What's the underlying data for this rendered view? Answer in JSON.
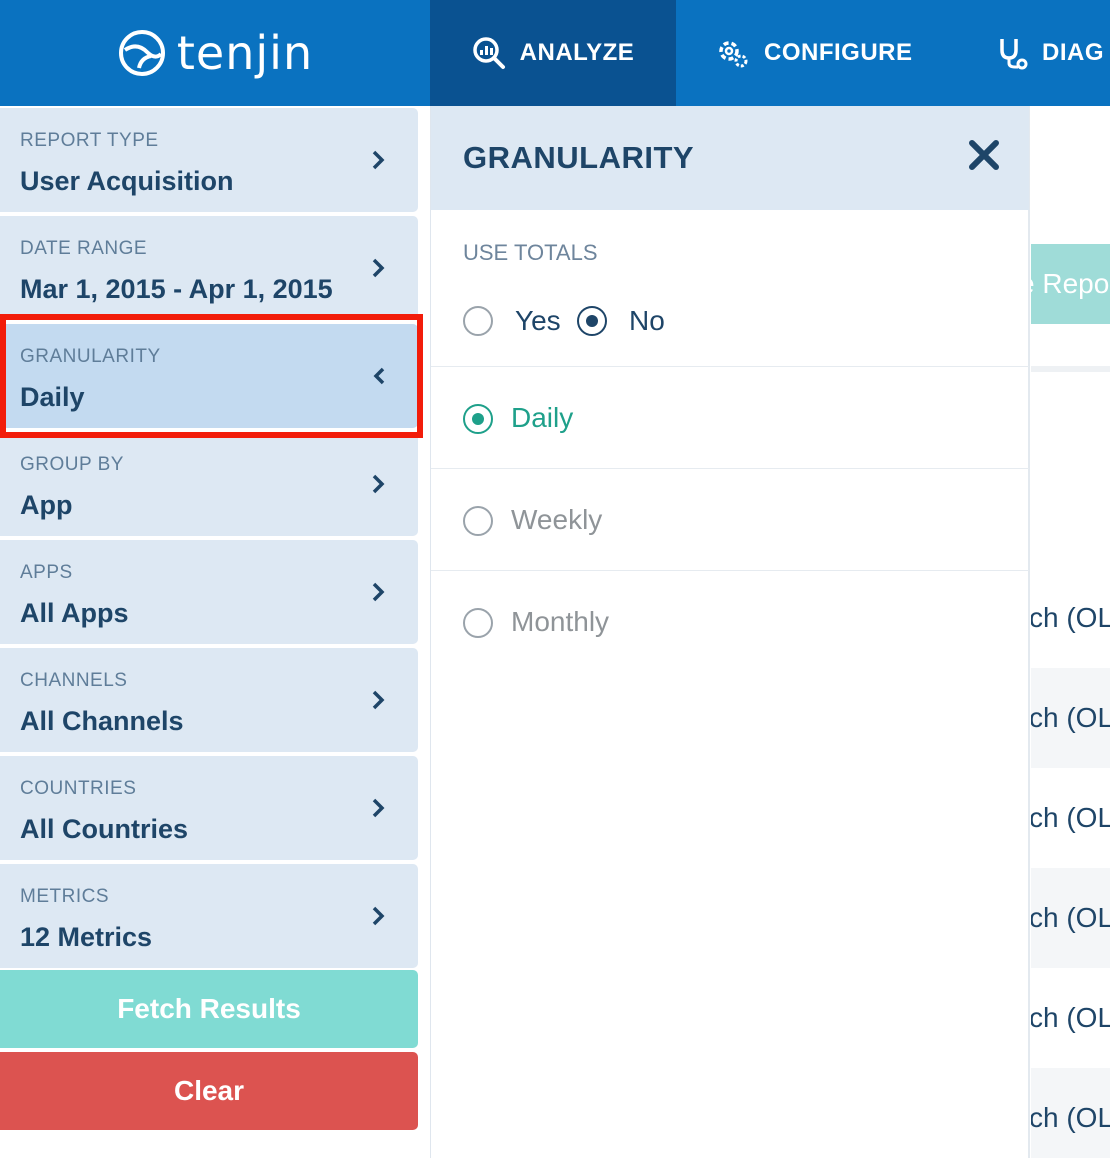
{
  "brand": {
    "name": "tenjin",
    "logo_icon": "tenjin-swirl-icon"
  },
  "nav": {
    "analyze": {
      "label": "ANALYZE",
      "icon": "analyze-magnifier-icon"
    },
    "configure": {
      "label": "CONFIGURE",
      "icon": "gear-icon"
    },
    "diag": {
      "label": "DIAG",
      "icon": "stethoscope-icon"
    }
  },
  "sidebar": {
    "filters": [
      {
        "label": "REPORT TYPE",
        "value": "User Acquisition"
      },
      {
        "label": "DATE RANGE",
        "value": "Mar 1, 2015 - Apr 1, 2015"
      },
      {
        "label": "GRANULARITY",
        "value": "Daily",
        "active": true
      },
      {
        "label": "GROUP BY",
        "value": "App"
      },
      {
        "label": "APPS",
        "value": "All Apps"
      },
      {
        "label": "CHANNELS",
        "value": "All Channels"
      },
      {
        "label": "COUNTRIES",
        "value": "All Countries"
      },
      {
        "label": "METRICS",
        "value": "12 Metrics"
      }
    ],
    "fetch_label": "Fetch Results",
    "clear_label": "Clear"
  },
  "panel": {
    "title": "GRANULARITY",
    "totals_label": "USE TOTALS",
    "totals_options": [
      {
        "label": "Yes",
        "checked": false
      },
      {
        "label": "No",
        "checked": true
      }
    ],
    "granularity_options": [
      {
        "label": "Daily",
        "checked": true
      },
      {
        "label": "Weekly",
        "checked": false
      },
      {
        "label": "Monthly",
        "checked": false
      }
    ]
  },
  "background": {
    "report_button_fragment": "e Repo",
    "row_fragments": [
      "ch (OL",
      "ch (OL",
      "ch (OL",
      "ch (OL",
      "ch (OL",
      "ch (OL"
    ]
  },
  "colors": {
    "nav_bg": "#0a72c0",
    "nav_active": "#0a5291",
    "card_bg": "#dde8f3",
    "card_active": "#c3daf0",
    "highlight": "#f21c0a",
    "fetch": "#80dbd3",
    "clear": "#dc5350",
    "selected_green": "#1ea08a"
  }
}
